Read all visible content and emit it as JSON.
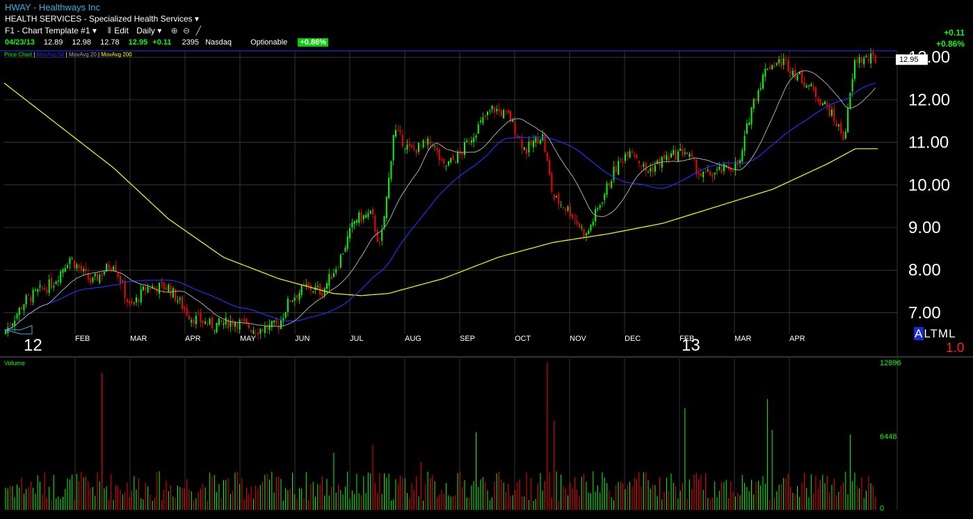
{
  "header": {
    "symbol_line": "HWAY - Healthways Inc",
    "industry": "HEALTH SERVICES - Specialized Health Services",
    "template": "F1 - Chart Template #1",
    "edit": "Edit",
    "period": "Daily",
    "quote": {
      "date": "04/23/13",
      "open": "12.89",
      "high": "12.98",
      "low": "12.78",
      "last": "12.95",
      "change": "+0.11",
      "volume": "2395",
      "exchange": "Nasdaq",
      "optionable": "Optionable",
      "pct": "+0.86%"
    },
    "right_change": "+0.11",
    "right_pct": "+0.86%"
  },
  "legend": {
    "price_chart": "Price Chart",
    "ma50": "MovAvg 50",
    "ma20": "MovAvg 20",
    "ma200": "MovAvg 200"
  },
  "volume_title": "Volume",
  "altml": {
    "a": "A",
    "rest": "LTML"
  },
  "ratio": "1.0",
  "colors": {
    "up": "#00ff00",
    "down": "#ff0000",
    "ma20": "#aaaaaa",
    "ma50": "#2030ff",
    "ma200": "#ffff00",
    "grid": "#555555"
  },
  "chart_data": {
    "type": "candlestick",
    "price_axis": {
      "ticks": [
        7.0,
        8.0,
        9.0,
        10.0,
        11.0,
        12.0,
        13.0
      ],
      "labels": [
        "7.00",
        "8.00",
        "9.00",
        "10.00",
        "11.00",
        "12.00",
        "13.00"
      ],
      "range": [
        6.5,
        13.15
      ]
    },
    "last_price_label": "12.95",
    "months": [
      {
        "label": "FEB",
        "year": "12"
      },
      {
        "label": "MAR"
      },
      {
        "label": "APR"
      },
      {
        "label": "MAY"
      },
      {
        "label": "JUN"
      },
      {
        "label": "JUL"
      },
      {
        "label": "AUG"
      },
      {
        "label": "SEP"
      },
      {
        "label": "OCT"
      },
      {
        "label": "NOV"
      },
      {
        "label": "DEC"
      },
      {
        "label": "FEB",
        "year": "13"
      },
      {
        "label": "MAR"
      },
      {
        "label": "APR"
      }
    ],
    "close_anchors": [
      {
        "m": 0.0,
        "c": 6.5
      },
      {
        "m": 0.4,
        "c": 7.3
      },
      {
        "m": 0.9,
        "c": 7.7
      },
      {
        "m": 1.2,
        "c": 8.3
      },
      {
        "m": 1.6,
        "c": 7.7
      },
      {
        "m": 2.0,
        "c": 8.2
      },
      {
        "m": 2.3,
        "c": 7.1
      },
      {
        "m": 2.6,
        "c": 7.6
      },
      {
        "m": 3.0,
        "c": 7.6
      },
      {
        "m": 3.4,
        "c": 6.9
      },
      {
        "m": 3.8,
        "c": 6.7
      },
      {
        "m": 4.2,
        "c": 6.8
      },
      {
        "m": 4.6,
        "c": 6.6
      },
      {
        "m": 5.0,
        "c": 6.7
      },
      {
        "m": 5.2,
        "c": 7.3
      },
      {
        "m": 5.5,
        "c": 7.6
      },
      {
        "m": 5.8,
        "c": 7.5
      },
      {
        "m": 6.1,
        "c": 8.2
      },
      {
        "m": 6.4,
        "c": 9.2
      },
      {
        "m": 6.7,
        "c": 9.3
      },
      {
        "m": 6.85,
        "c": 8.5
      },
      {
        "m": 7.0,
        "c": 10.0
      },
      {
        "m": 7.1,
        "c": 11.3
      },
      {
        "m": 7.4,
        "c": 10.8
      },
      {
        "m": 7.8,
        "c": 11.0
      },
      {
        "m": 8.0,
        "c": 10.4
      },
      {
        "m": 8.3,
        "c": 10.7
      },
      {
        "m": 8.6,
        "c": 11.3
      },
      {
        "m": 8.9,
        "c": 11.8
      },
      {
        "m": 9.2,
        "c": 11.6
      },
      {
        "m": 9.5,
        "c": 10.8
      },
      {
        "m": 9.8,
        "c": 11.2
      },
      {
        "m": 10.0,
        "c": 9.7
      },
      {
        "m": 10.3,
        "c": 9.4
      },
      {
        "m": 10.6,
        "c": 8.8
      },
      {
        "m": 10.8,
        "c": 9.4
      },
      {
        "m": 11.1,
        "c": 10.3
      },
      {
        "m": 11.4,
        "c": 10.9
      },
      {
        "m": 11.7,
        "c": 10.3
      },
      {
        "m": 12.0,
        "c": 10.6
      },
      {
        "m": 12.4,
        "c": 10.8
      },
      {
        "m": 12.7,
        "c": 10.2
      },
      {
        "m": 13.0,
        "c": 10.3
      },
      {
        "m": 13.4,
        "c": 10.5
      },
      {
        "m": 13.6,
        "c": 11.8
      },
      {
        "m": 13.9,
        "c": 12.8
      },
      {
        "m": 14.2,
        "c": 12.9
      },
      {
        "m": 14.6,
        "c": 12.4
      },
      {
        "m": 15.0,
        "c": 11.8
      },
      {
        "m": 15.3,
        "c": 11.1
      },
      {
        "m": 15.5,
        "c": 12.95
      }
    ],
    "ma200_anchors": [
      {
        "m": 0.0,
        "c": 12.4
      },
      {
        "m": 1.0,
        "c": 11.4
      },
      {
        "m": 2.0,
        "c": 10.4
      },
      {
        "m": 3.0,
        "c": 9.2
      },
      {
        "m": 4.0,
        "c": 8.3
      },
      {
        "m": 5.0,
        "c": 7.8
      },
      {
        "m": 6.0,
        "c": 7.45
      },
      {
        "m": 6.5,
        "c": 7.4
      },
      {
        "m": 7.0,
        "c": 7.45
      },
      {
        "m": 8.0,
        "c": 7.8
      },
      {
        "m": 9.0,
        "c": 8.3
      },
      {
        "m": 10.0,
        "c": 8.65
      },
      {
        "m": 11.0,
        "c": 8.85
      },
      {
        "m": 12.0,
        "c": 9.1
      },
      {
        "m": 13.0,
        "c": 9.5
      },
      {
        "m": 14.0,
        "c": 9.9
      },
      {
        "m": 15.0,
        "c": 10.5
      },
      {
        "m": 15.5,
        "c": 10.85
      }
    ],
    "volume_axis": {
      "ticks": [
        0,
        6448,
        12896
      ],
      "labels": [
        "0",
        "6448",
        "12896"
      ]
    },
    "volume_spikes": [
      {
        "m": 1.8,
        "v": 12000
      },
      {
        "m": 6.0,
        "v": 5000
      },
      {
        "m": 6.7,
        "v": 5700
      },
      {
        "m": 7.6,
        "v": 4200
      },
      {
        "m": 8.6,
        "v": 6800
      },
      {
        "m": 9.9,
        "v": 12896
      },
      {
        "m": 10.0,
        "v": 7800
      },
      {
        "m": 12.4,
        "v": 8900
      },
      {
        "m": 13.9,
        "v": 9700
      },
      {
        "m": 14.0,
        "v": 7000
      },
      {
        "m": 15.4,
        "v": 6600
      }
    ]
  }
}
